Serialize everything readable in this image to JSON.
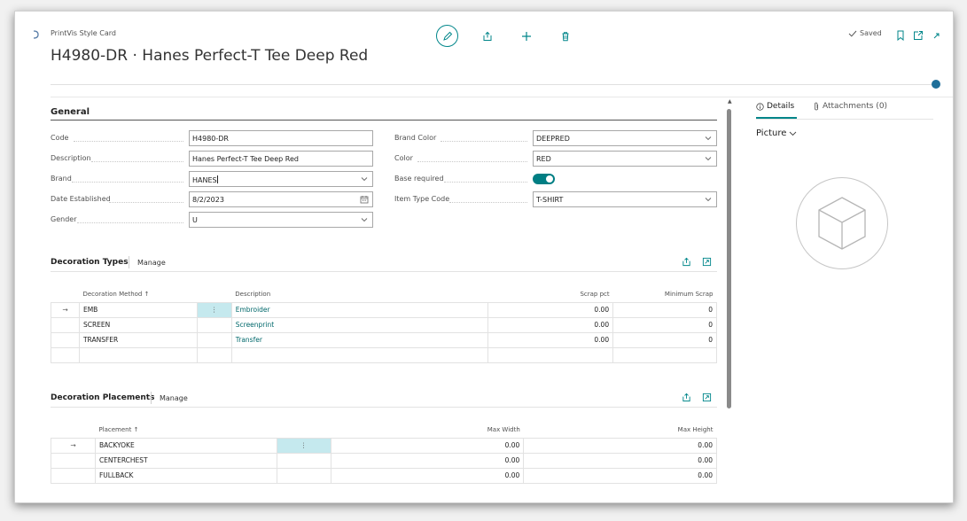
{
  "header": {
    "card_type": "PrintVis Style Card",
    "title": "H4980-DR · Hanes Perfect-T Tee Deep Red",
    "saved_label": "Saved"
  },
  "general": {
    "title": "General",
    "fields_left": [
      {
        "label": "Code",
        "value": "H4980-DR",
        "kind": "text"
      },
      {
        "label": "Description",
        "value": "Hanes Perfect-T Tee Deep Red",
        "kind": "text"
      },
      {
        "label": "Brand",
        "value": "HANES",
        "kind": "select"
      },
      {
        "label": "Date Established",
        "value": "8/2/2023",
        "kind": "date"
      },
      {
        "label": "Gender",
        "value": "U",
        "kind": "select"
      }
    ],
    "fields_right": [
      {
        "label": "Brand Color",
        "value": "DEEPRED",
        "kind": "select"
      },
      {
        "label": "Color",
        "value": "RED",
        "kind": "select"
      },
      {
        "label": "Base required",
        "value": "",
        "kind": "toggle"
      },
      {
        "label": "Item Type Code",
        "value": "T-SHIRT",
        "kind": "select"
      }
    ]
  },
  "decoration_types": {
    "title": "Decoration Types",
    "manage_label": "Manage",
    "columns": [
      "Decoration Method ↑",
      "Description",
      "Scrap pct",
      "Minimum Scrap"
    ],
    "rows": [
      {
        "method": "EMB",
        "description": "Embroider",
        "scrap_pct": "0.00",
        "min_scrap": "0"
      },
      {
        "method": "SCREEN",
        "description": "Screenprint",
        "scrap_pct": "0.00",
        "min_scrap": "0"
      },
      {
        "method": "TRANSFER",
        "description": "Transfer",
        "scrap_pct": "0.00",
        "min_scrap": "0"
      }
    ]
  },
  "decoration_placements": {
    "title": "Decoration Placements",
    "manage_label": "Manage",
    "columns": [
      "Placement ↑",
      "Max Width",
      "Max Height"
    ],
    "rows": [
      {
        "placement": "BACKYOKE",
        "max_width": "0.00",
        "max_height": "0.00"
      },
      {
        "placement": "CENTERCHEST",
        "max_width": "0.00",
        "max_height": "0.00"
      },
      {
        "placement": "FULLBACK",
        "max_width": "0.00",
        "max_height": "0.00"
      }
    ]
  },
  "factbox": {
    "tab_details": "Details",
    "tab_attachments": "Attachments (0)",
    "picture_title": "Picture"
  },
  "colors": {
    "accent": "#00868a",
    "link": "#00686b",
    "selection": "#c5e9ee"
  }
}
